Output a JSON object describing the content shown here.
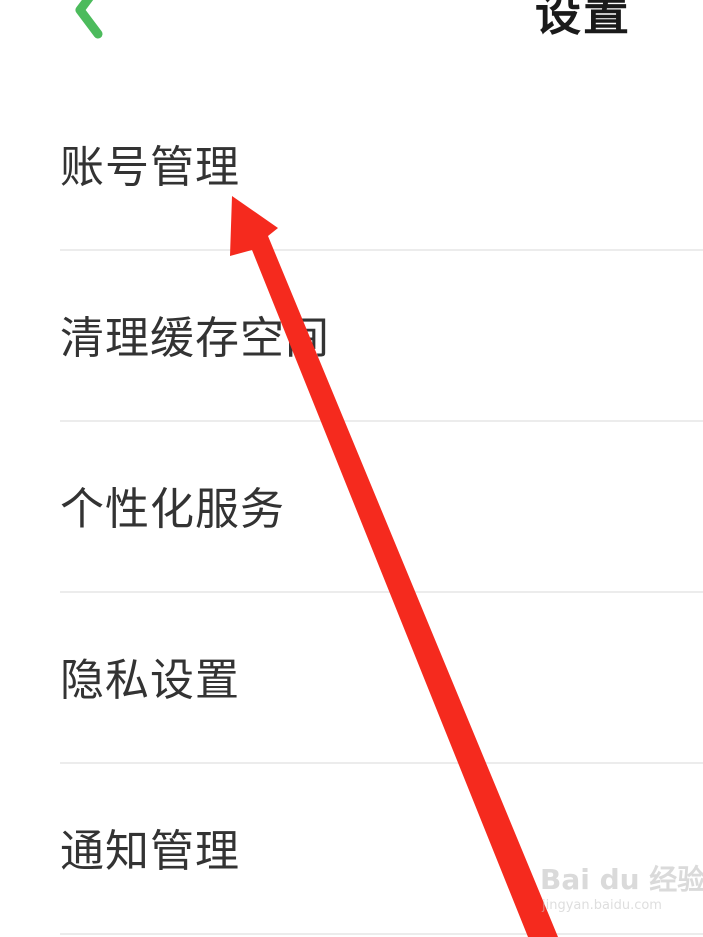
{
  "header": {
    "title": "设置",
    "back_icon": "chevron-left-icon",
    "accent_color": "#4cbb5c"
  },
  "menu": {
    "items": [
      {
        "label": "账号管理"
      },
      {
        "label": "清理缓存空间"
      },
      {
        "label": "个性化服务"
      },
      {
        "label": "隐私设置"
      },
      {
        "label": "通知管理"
      }
    ]
  },
  "annotation": {
    "arrow_color": "#f52a1e"
  },
  "watermark": {
    "logo": "Bai du 经验",
    "url": "jingyan.baidu.com"
  }
}
